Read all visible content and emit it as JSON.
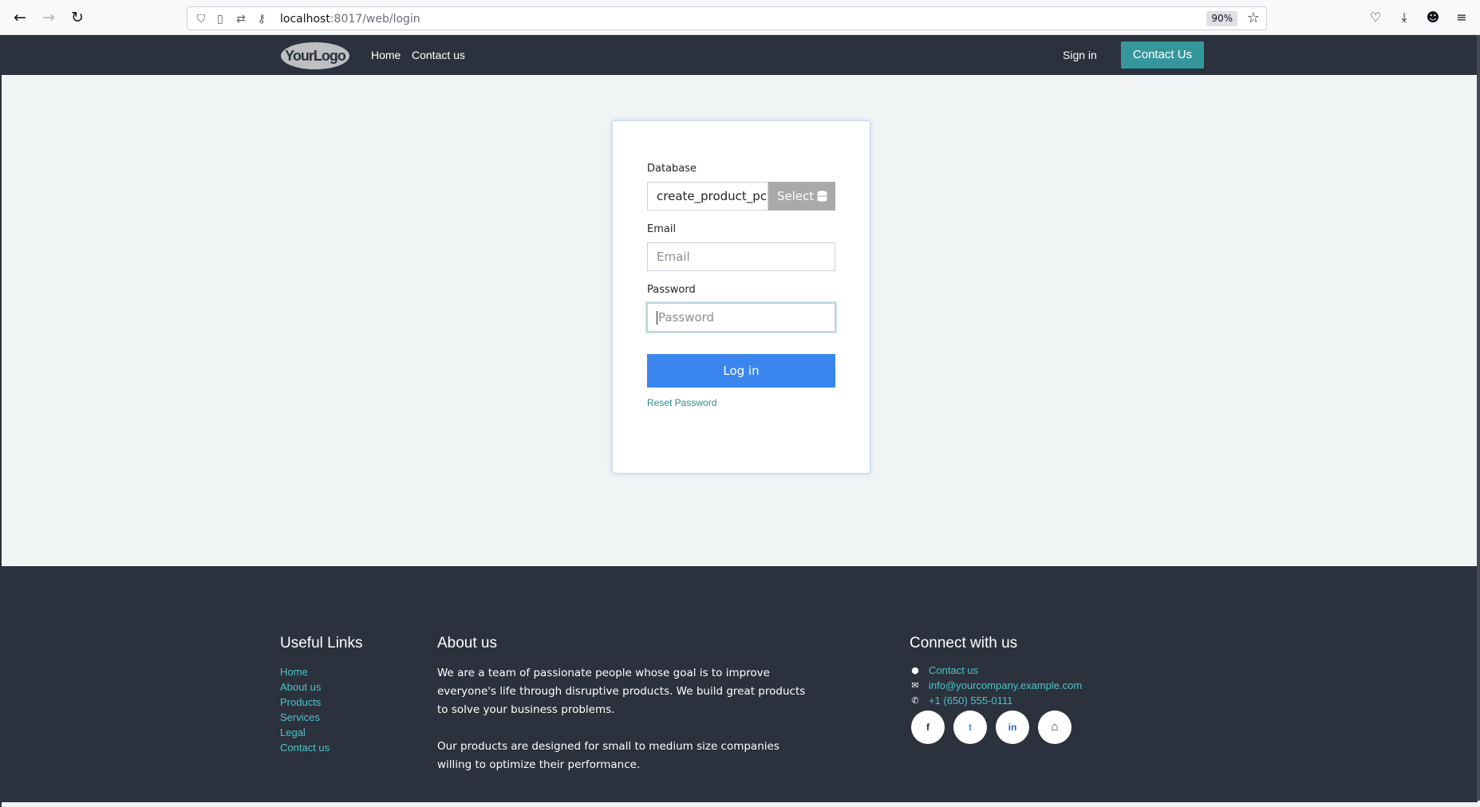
{
  "browser": {
    "url_host": "localhost",
    "url_rest": ":8017/web/login",
    "zoom": "90%"
  },
  "header": {
    "logo_text": "YourLogo",
    "nav": [
      "Home",
      "Contact us"
    ],
    "sign_in": "Sign in",
    "contact_button": "Contact Us"
  },
  "login": {
    "database_label": "Database",
    "database_value": "create_product_pc",
    "select_label": "Select",
    "email_label": "Email",
    "email_placeholder": "Email",
    "password_label": "Password",
    "password_placeholder": "Password",
    "login_button": "Log in",
    "reset_link": "Reset Password"
  },
  "footer": {
    "useful_links_heading": "Useful Links",
    "useful_links": [
      "Home",
      "About us",
      "Products",
      "Services",
      "Legal",
      "Contact us"
    ],
    "about_heading": "About us",
    "about_p1": "We are a team of passionate people whose goal is to improve everyone's life through disruptive products. We build great products to solve your business problems.",
    "about_p2": "Our products are designed for small to medium size companies willing to optimize their performance.",
    "connect_heading": "Connect with us",
    "connect_items": [
      {
        "icon": "comment-icon",
        "text": "Contact us"
      },
      {
        "icon": "envelope-icon",
        "text": "info@yourcompany.example.com"
      },
      {
        "icon": "phone-icon",
        "text": "+1 (650) 555-0111"
      }
    ],
    "social": [
      {
        "icon": "facebook-icon",
        "glyph": "f"
      },
      {
        "icon": "twitter-icon",
        "glyph": "t"
      },
      {
        "icon": "linkedin-icon",
        "glyph": "in"
      },
      {
        "icon": "home-icon",
        "glyph": "⌂"
      }
    ]
  }
}
